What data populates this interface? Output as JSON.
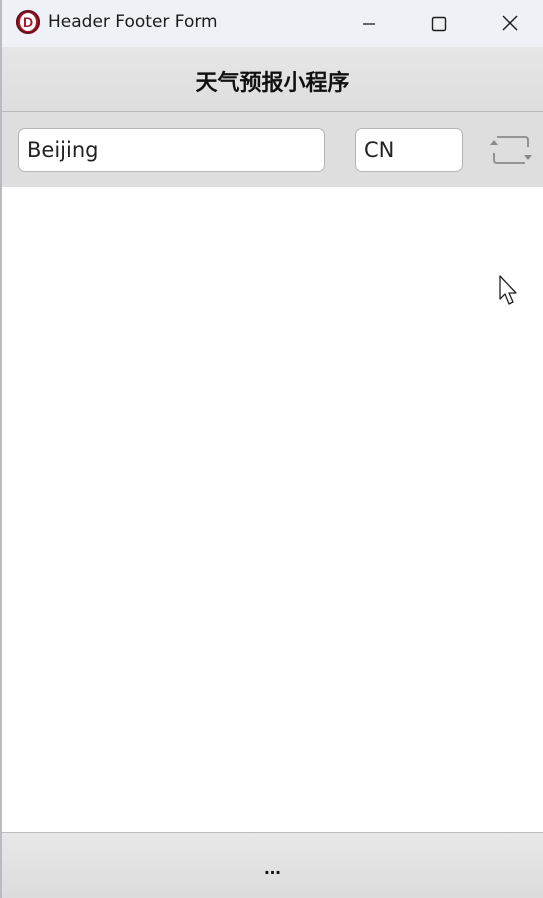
{
  "window": {
    "title": "Header Footer Form",
    "icon": "delphi-app-icon",
    "icon_letter": "D",
    "buttons": [
      "minimize-icon",
      "maximize-icon",
      "close-icon"
    ]
  },
  "header": {
    "title": "天气预报小程序"
  },
  "toolbar": {
    "city_value": "Beijing",
    "country_value": "CN",
    "refresh_icon": "refresh-icon"
  },
  "footer": {
    "text": "..."
  },
  "colors": {
    "titlebar_bg": "#eef2f7",
    "header_bg": "#e2e2e2",
    "toolbar_bg": "#dedede",
    "app_icon": "#a0182a"
  }
}
